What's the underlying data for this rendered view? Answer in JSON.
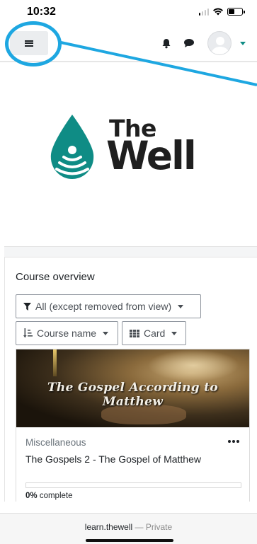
{
  "status_bar": {
    "time": "10:32",
    "icons": [
      "cellular-signal-icon",
      "wifi-icon",
      "battery-icon"
    ]
  },
  "navbar": {
    "menu_icon": "hamburger-icon",
    "notification_icon": "bell-icon",
    "message_icon": "chat-bubble-icon",
    "avatar_icon": "user-avatar-icon",
    "user_menu_icon": "caret-down-icon"
  },
  "annotation": {
    "color": "#1ea7e1",
    "shape": "circle-highlight-with-pointer-line"
  },
  "logo": {
    "line1": "The",
    "line2": "Well",
    "mark_icon": "water-drop-icon",
    "brand_color": "#0f8c85"
  },
  "course_overview": {
    "title": "Course overview",
    "filter": {
      "label": "All (except removed from view)",
      "icon": "filter-icon"
    },
    "sort": {
      "label": "Course name",
      "icon": "sort-icon"
    },
    "view": {
      "label": "Card",
      "icon": "grid-icon"
    },
    "courses": [
      {
        "image_title": "The Gospel According to Matthew",
        "category": "Miscellaneous",
        "name": "The Gospels 2 - The Gospel of Matthew",
        "progress_value": "0%",
        "progress_suffix": " complete",
        "progress_fraction": 0,
        "menu_icon": "more-options-icon"
      }
    ]
  },
  "browser": {
    "url": "learn.thewell",
    "separator": " — ",
    "mode": "Private"
  }
}
